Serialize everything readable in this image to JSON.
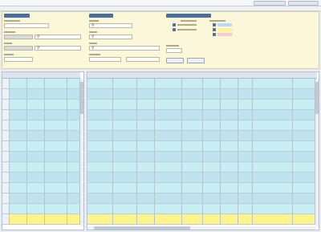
{
  "colors": {
    "filter_panel": "#fbf7d9",
    "row_cyan": "#c8eef3",
    "row_blue": "#bfe4f0",
    "row_selected": "#fff38a",
    "group_header": "#4b6ea0",
    "legend": [
      "#b9d7ff",
      "#fff38a",
      "#ffc9c9"
    ]
  },
  "icons": {
    "field_search": "search-icon"
  }
}
